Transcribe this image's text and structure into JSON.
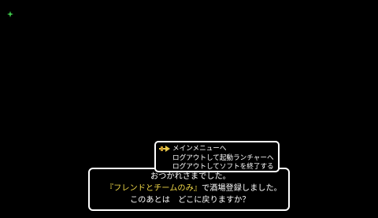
{
  "colors": {
    "background": "#000000",
    "text": "#ffffff",
    "highlight": "#f0d848",
    "cursor": "#e8c848",
    "sparkle": "#3ec84a"
  },
  "icons": {
    "corner": "sparkle-icon",
    "cursor": "cursor-hand-icon"
  },
  "menu": {
    "items": [
      {
        "label": "メインメニューへ",
        "selected": true
      },
      {
        "label": "ログアウトして起動ランチャーへ",
        "selected": false
      },
      {
        "label": "ログアウトしてソフトを終了する",
        "selected": false
      }
    ]
  },
  "message": {
    "line1": "おつかれさまでした。",
    "line2_highlight": "『フレンドとチームのみ』",
    "line2_rest": "で酒場登録しました。",
    "line3": "このあとは　どこに戻りますか？"
  }
}
